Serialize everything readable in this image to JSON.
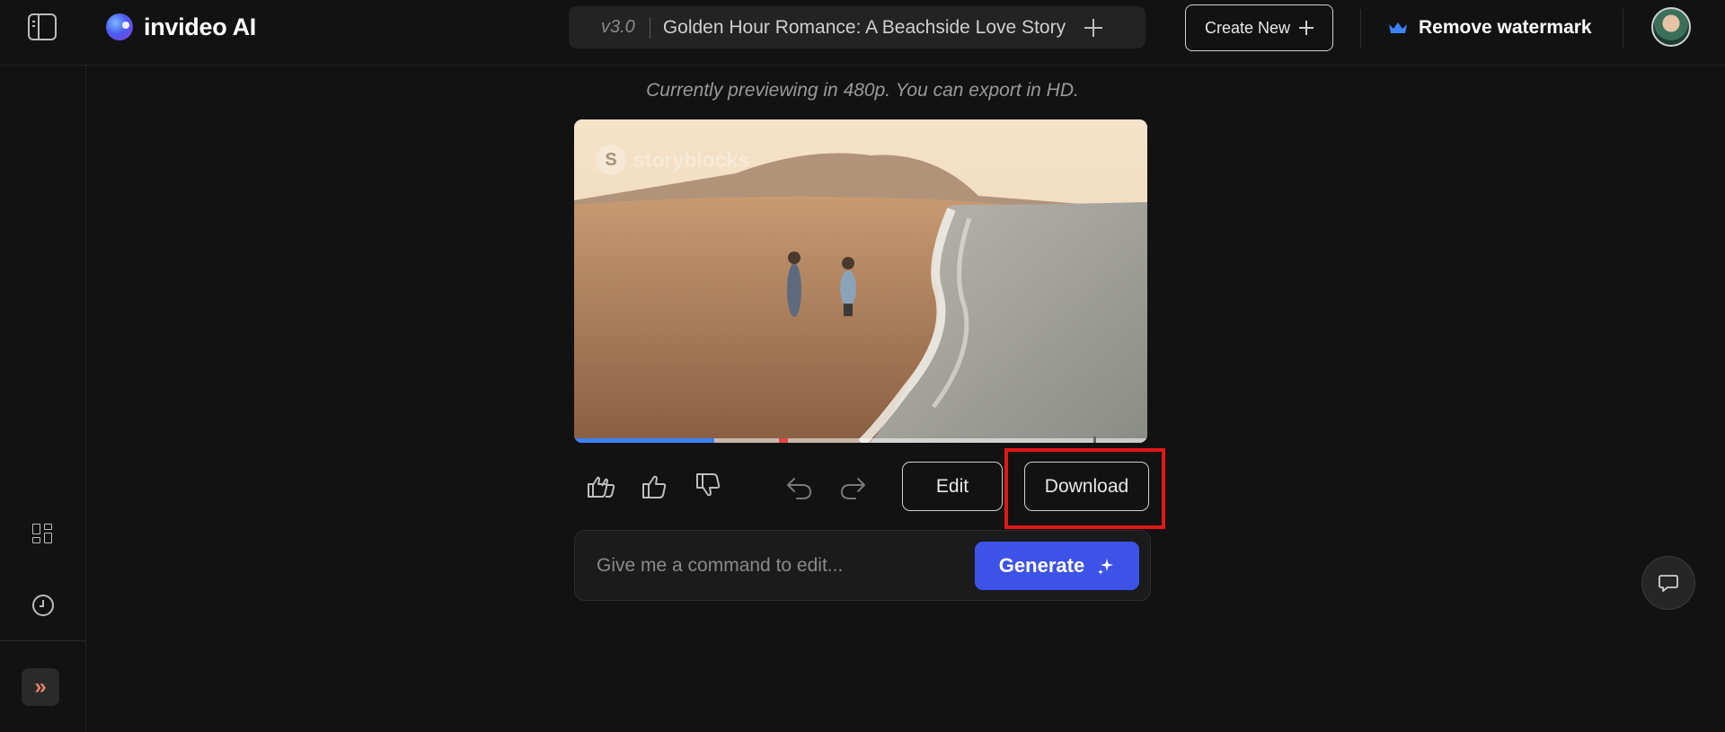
{
  "header": {
    "brand_name": "invideo AI",
    "project": {
      "version": "v3.0",
      "title": "Golden Hour Romance: A Beachside Love Story"
    },
    "create_new_label": "Create New",
    "remove_watermark_label": "Remove watermark",
    "icons": {
      "sidebar_toggle": "sidebar-toggle-icon",
      "add_scene": "plus-icon",
      "create_new": "plus-icon",
      "watermark": "crown-icon"
    }
  },
  "sidebar": {
    "items": [
      {
        "icon": "grid-icon"
      },
      {
        "icon": "clock-icon"
      }
    ],
    "expand_label": "»"
  },
  "main": {
    "preview_note": "Currently previewing in 480p. You can export in HD.",
    "video": {
      "watermark_text": "storyblocks",
      "watermark_logo": "S",
      "progress_fraction": 0.245
    },
    "actions": {
      "feedback_icons": [
        "double-thumbs-up-icon",
        "thumbs-up-icon",
        "thumbs-down-icon"
      ],
      "history_icons": [
        "undo-icon",
        "redo-icon"
      ],
      "edit_label": "Edit",
      "download_label": "Download"
    },
    "command": {
      "placeholder": "Give me a command to edit...",
      "value": "",
      "generate_label": "Generate"
    }
  },
  "colors": {
    "background": "#121212",
    "accent": "#3d52e6",
    "highlight": "#e01818",
    "progress": "#3b82f6"
  }
}
